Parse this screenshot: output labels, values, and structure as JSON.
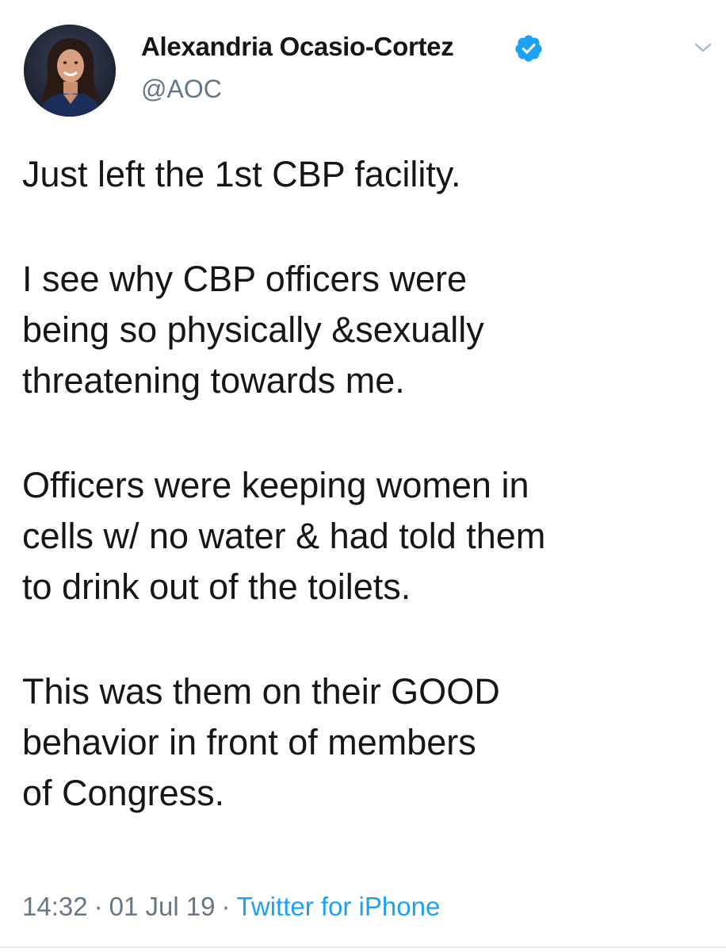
{
  "author": {
    "display_name": "Alexandria Ocasio-Cortez",
    "handle": "@AOC",
    "verified": true,
    "avatar_icon": "profile-photo"
  },
  "tweet": {
    "paragraphs": [
      "Just left the 1st CBP facility.",
      "I see why CBP officers were\nbeing so physically &sexually\nthreatening towards me.",
      "Officers were keeping women in\ncells w/ no water & had told them\nto drink out of the toilets.",
      "This was them on their GOOD\nbehavior in front of members\nof Congress."
    ]
  },
  "meta": {
    "time": "14:32",
    "separator": "·",
    "date": "01 Jul 19",
    "source": "Twitter for iPhone"
  },
  "icons": {
    "verified_badge": "verified-badge-icon",
    "more_menu": "chevron-down-icon"
  },
  "colors": {
    "text_primary": "#14171a",
    "text_secondary": "#657786",
    "accent": "#1da1f2",
    "divider": "#e6ecf0"
  }
}
